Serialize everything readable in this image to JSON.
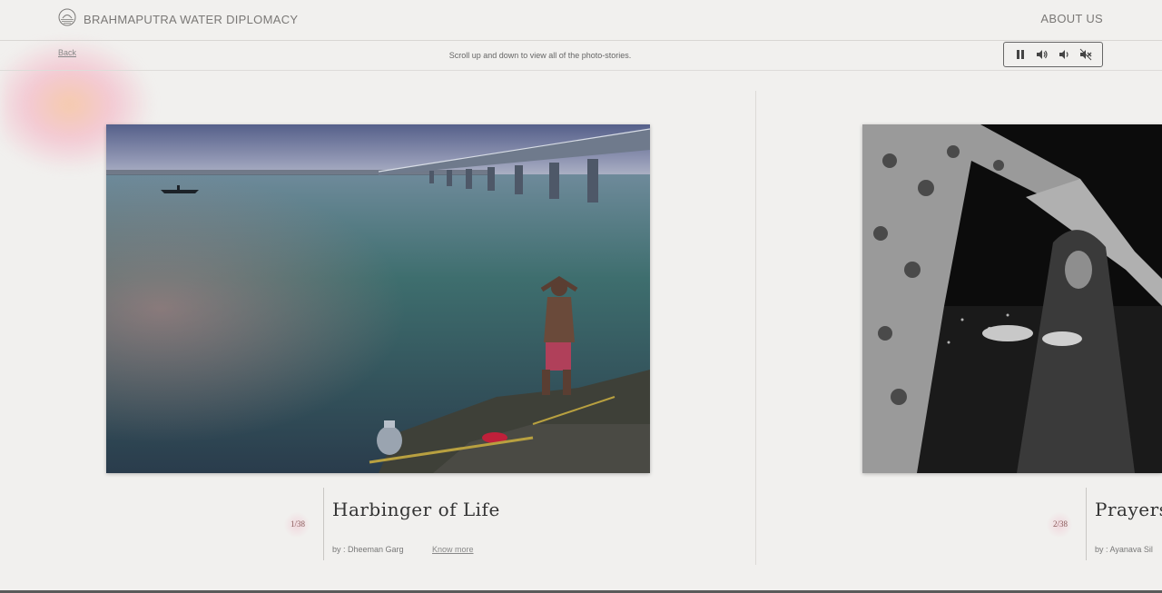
{
  "header": {
    "logo_text": "BRAHMAPUTRA WATER DIPLOMACY",
    "about_label": "ABOUT US"
  },
  "subbar": {
    "back_label": "Back",
    "hint": "Scroll up and down to view all of the photo-stories."
  },
  "audio_controls": [
    "pause-icon",
    "volume-high-icon",
    "volume-low-icon",
    "mute-icon"
  ],
  "stories": [
    {
      "counter": "1/38",
      "title": "Harbinger of Life",
      "author": "by : Dheeman Garg",
      "link": "Know more"
    },
    {
      "counter": "2/38",
      "title": "Prayers",
      "author": "by : Ayanava Sil"
    }
  ],
  "colors": {
    "background": "#f1f0ee",
    "text": "#555555",
    "accent_glow": "#f5b9a0"
  }
}
